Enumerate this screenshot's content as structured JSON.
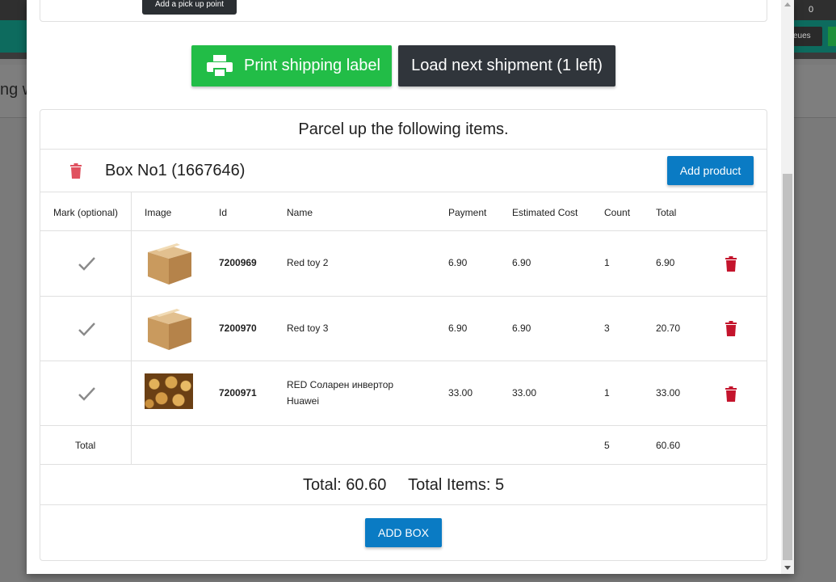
{
  "background": {
    "left_text": "ng w",
    "badge_count": "0",
    "queues_label": "eues"
  },
  "tooltip": "Add a pick up point",
  "actions": {
    "print_label": "Print shipping label",
    "next_shipment": "Load next shipment (1 left)"
  },
  "parcel": {
    "title": "Parcel up the following items.",
    "box_title": "Box No1 (1667646)",
    "add_product": "Add product"
  },
  "table": {
    "headers": [
      "Mark (optional)",
      "Image",
      "Id",
      "Name",
      "Payment",
      "Estimated Cost",
      "Count",
      "Total"
    ],
    "rows": [
      {
        "id": "7200969",
        "name": "Red toy 2",
        "payment": "6.90",
        "cost": "6.90",
        "count": "1",
        "total": "6.90",
        "image": "cardboard-box-icon"
      },
      {
        "id": "7200970",
        "name": "Red toy 3",
        "payment": "6.90",
        "cost": "6.90",
        "count": "3",
        "total": "20.70",
        "image": "cardboard-box-icon"
      },
      {
        "id": "7200971",
        "name_line1": "RED Соларен инвертор",
        "name_line2": "Huawei",
        "payment": "33.00",
        "cost": "33.00",
        "count": "1",
        "total": "33.00",
        "image": "potatoes-photo"
      }
    ],
    "total_label": "Total",
    "total_count": "5",
    "total_sum": "60.60"
  },
  "summary": {
    "total": "Total: 60.60",
    "items": "Total Items: 5"
  },
  "add_box": "ADD BOX",
  "colors": {
    "green": "#22bd47",
    "dark": "#30353b",
    "blue": "#0a7bc4",
    "red_trash": "#c4142c"
  }
}
